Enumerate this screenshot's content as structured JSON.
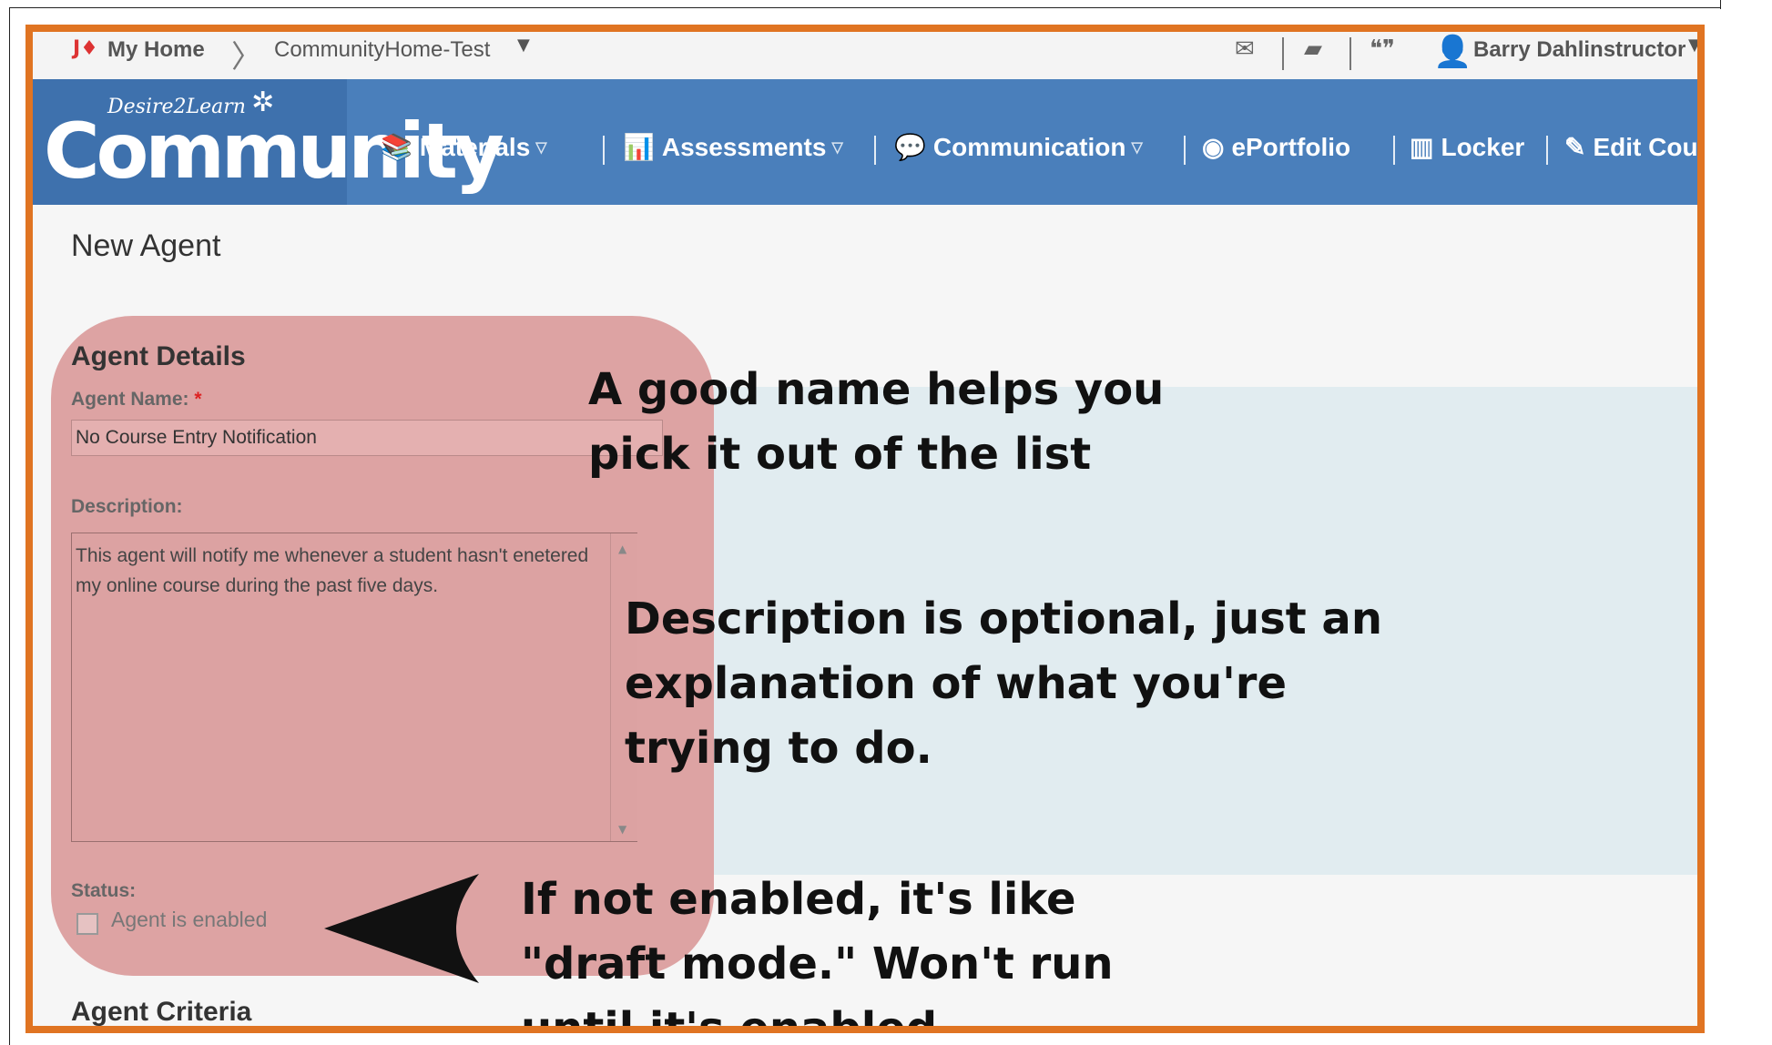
{
  "topbar": {
    "home_icon": "d2l-home-icon",
    "my_home": "My Home",
    "breadcrumb_sep": "〉",
    "org_selector": "CommunityHome-Test",
    "icons": [
      "messages-icon",
      "updates-icon",
      "subscriptions-icon"
    ],
    "user_name": "Barry Dahlinstructor"
  },
  "logo": {
    "small": "Desire2Learn",
    "big": "Community"
  },
  "nav": {
    "items": [
      {
        "label": "Materials",
        "icon": "materials-icon",
        "dropdown": true
      },
      {
        "label": "Assessments",
        "icon": "assessments-icon",
        "dropdown": true
      },
      {
        "label": "Communication",
        "icon": "communication-icon",
        "dropdown": true
      },
      {
        "label": "ePortfolio",
        "icon": "eportfolio-icon",
        "dropdown": false
      },
      {
        "label": "Locker",
        "icon": "locker-icon",
        "dropdown": false
      },
      {
        "label": "Edit Course",
        "icon": "edit-course-icon",
        "dropdown": false
      }
    ]
  },
  "page": {
    "title": "New Agent"
  },
  "agent_details": {
    "heading": "Agent Details",
    "name_label": "Agent Name:",
    "required_marker": "*",
    "name_value": "No Course Entry Notification",
    "description_label": "Description:",
    "description_value": "This agent will notify me whenever a student hasn't enetered my online course during the past five days.",
    "status_label": "Status:",
    "enabled_label": "Agent is enabled",
    "enabled_checked": false
  },
  "agent_criteria": {
    "heading": "Agent Criteria"
  },
  "annotations": {
    "name_note": "A good name helps you\npick it out of the list",
    "description_note": "Description is optional, just an\nexplanation of what you're\ntrying to do.",
    "status_note": "If not enabled, it's like\n\"draft mode.\" Won't run\nuntil it's enabled."
  },
  "colors": {
    "frame_border": "#e07422",
    "navbar": "#4a7fbb",
    "highlight_pink": "#dda3a3",
    "highlight_blue": "#e1ecf0"
  }
}
